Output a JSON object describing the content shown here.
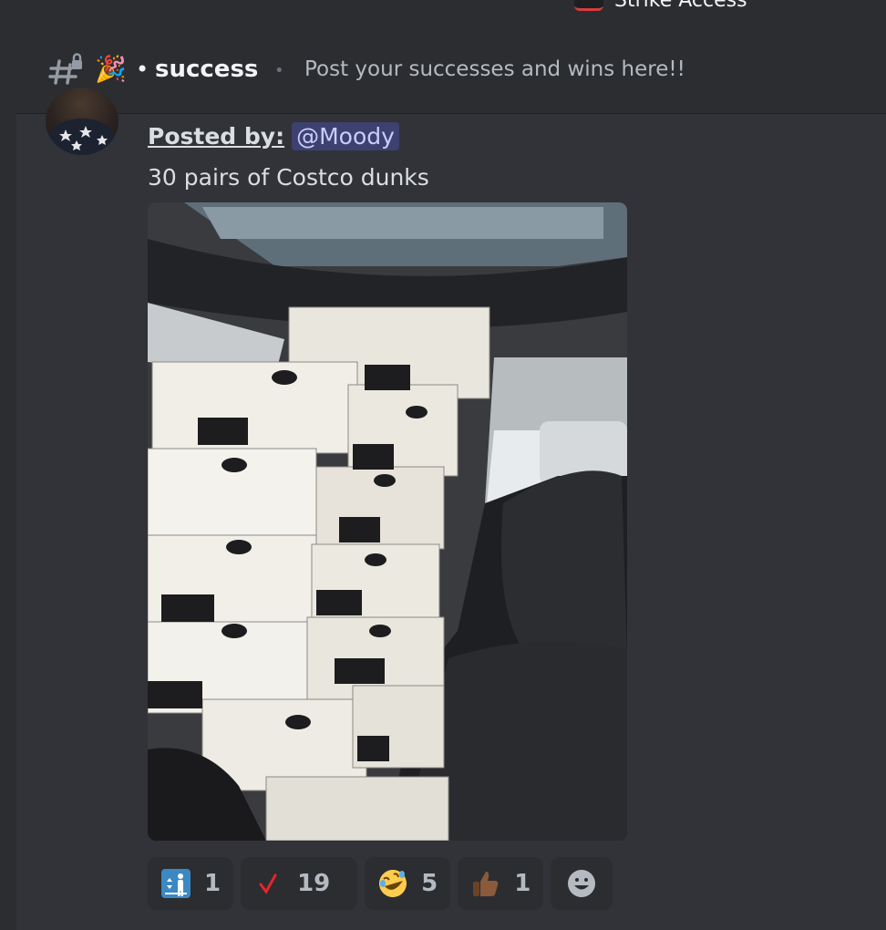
{
  "server": {
    "name": "Strike Access"
  },
  "channel": {
    "name": "success",
    "topic": "Post your successes and wins here!!",
    "icons": [
      "hash-lock-icon",
      "party-popper-icon"
    ]
  },
  "message": {
    "posted_label": "Posted by:",
    "mention": "@Moody",
    "text": "30 pairs of Costco dunks",
    "attachment": "photo-shoeboxes-in-car"
  },
  "reactions": [
    {
      "emoji": "person-elevator-icon",
      "count": "1"
    },
    {
      "emoji": "red-check-icon",
      "count": "19"
    },
    {
      "emoji": "rofl-icon",
      "count": "5"
    },
    {
      "emoji": "thumbs-up-icon",
      "count": "1"
    }
  ],
  "colors": {
    "background": "#313338",
    "header": "#2b2d31",
    "mention": "#c9cdfb"
  }
}
